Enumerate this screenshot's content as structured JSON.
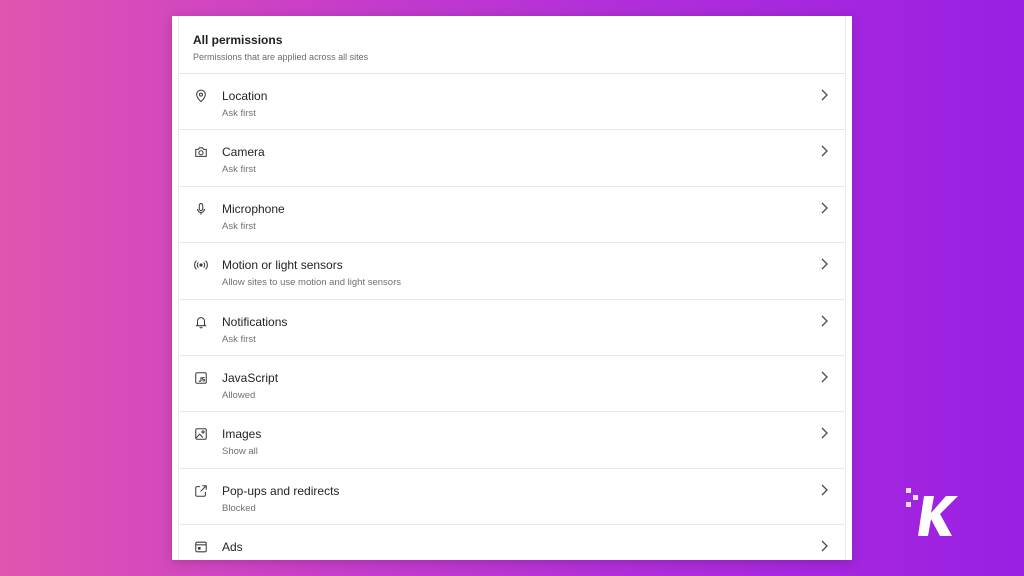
{
  "section": {
    "title": "All permissions",
    "subtitle": "Permissions that are applied across all sites"
  },
  "permissions": [
    {
      "label": "Location",
      "status": "Ask first",
      "icon": "location-pin-icon"
    },
    {
      "label": "Camera",
      "status": "Ask first",
      "icon": "camera-icon"
    },
    {
      "label": "Microphone",
      "status": "Ask first",
      "icon": "microphone-icon"
    },
    {
      "label": "Motion or light sensors",
      "status": "Allow sites to use motion and light sensors",
      "icon": "sensor-waves-icon"
    },
    {
      "label": "Notifications",
      "status": "Ask first",
      "icon": "bell-icon"
    },
    {
      "label": "JavaScript",
      "status": "Allowed",
      "icon": "javascript-icon"
    },
    {
      "label": "Images",
      "status": "Show all",
      "icon": "image-icon"
    },
    {
      "label": "Pop-ups and redirects",
      "status": "Blocked",
      "icon": "external-link-icon"
    },
    {
      "label": "Ads",
      "status": "",
      "icon": "ads-icon"
    }
  ],
  "colors": {
    "background_start": "#e055b0",
    "background_end": "#9a1fe3",
    "panel": "#ffffff",
    "text_primary": "#242424",
    "text_secondary": "#707070"
  },
  "watermark": {
    "icon": "k-logo-icon"
  }
}
